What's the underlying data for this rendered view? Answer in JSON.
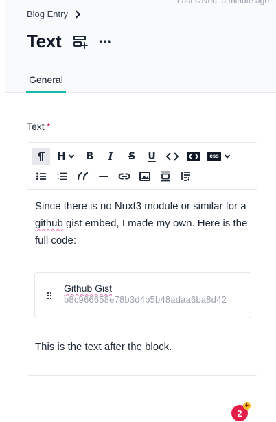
{
  "header": {
    "last_saved": "Last saved: a minute ago",
    "breadcrumb": {
      "item": "Blog Entry"
    },
    "title": "Text",
    "icons": {
      "layout": "layout-add-icon",
      "more": "more-horizontal-icon"
    }
  },
  "tabs": [
    {
      "label": "General",
      "active": true
    }
  ],
  "field": {
    "label": "Text",
    "required_mark": "*"
  },
  "toolbar": {
    "row1": [
      "paragraph",
      "heading",
      "bold",
      "italic",
      "strikethrough",
      "underline",
      "code",
      "code-block",
      "css"
    ],
    "row2": [
      "bullet-list",
      "ordered-list",
      "blockquote",
      "horizontal-rule",
      "link",
      "image",
      "embed",
      "text-wrap"
    ],
    "labels": {
      "heading": "H",
      "bold": "B",
      "italic": "I",
      "strike": "S",
      "underline": "U",
      "css": "css"
    }
  },
  "content": {
    "para1": {
      "before": "Since there is no Nuxt3 module or similar for a ",
      "squiggle": "github",
      "after": " gist embed, I made my own. Here is the full code:"
    },
    "block": {
      "title": "Github Gist",
      "id": "b8c966658e78b3d4b5b48adaa6ba8d42"
    },
    "para2": "This is the text after the block."
  },
  "badge": {
    "count": "2",
    "plus": "+"
  },
  "colors": {
    "accent": "#14b8a6",
    "required": "#e11d48",
    "badge": "#e11d48"
  }
}
